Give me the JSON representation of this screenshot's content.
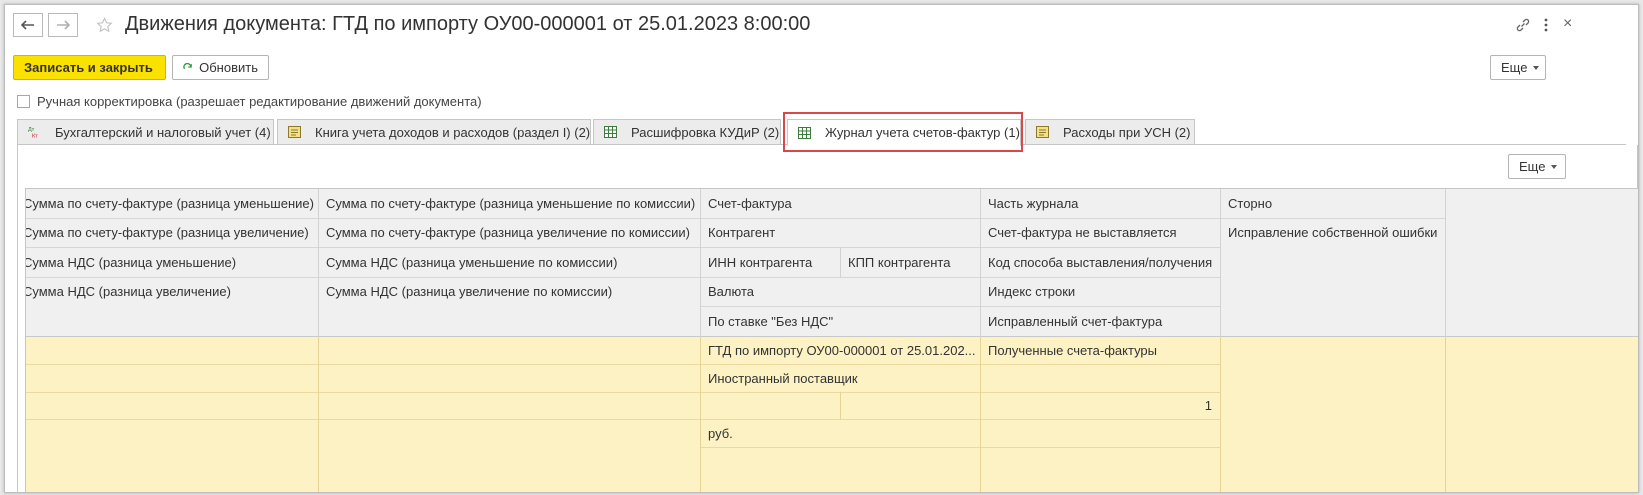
{
  "window": {
    "title": "Движения документа: ГТД по импорту ОУ00-000001 от 25.01.2023 8:00:00"
  },
  "toolbar": {
    "save_close": "Записать и закрыть",
    "refresh": "Обновить",
    "more": "Еще"
  },
  "manual_edit": {
    "label": "Ручная корректировка (разрешает редактирование движений документа)",
    "checked": false
  },
  "tabs": [
    {
      "label": "Бухгалтерский и налоговый учет (4)",
      "icon": "accounting-dt-kt-icon"
    },
    {
      "label": "Книга учета доходов и расходов (раздел I) (2)",
      "icon": "register-icon"
    },
    {
      "label": "Расшифровка КУДиР (2)",
      "icon": "table-icon"
    },
    {
      "label": "Журнал учета счетов-фактур (1)",
      "icon": "table-icon",
      "active": true
    },
    {
      "label": "Расходы при УСН (2)",
      "icon": "register-icon"
    }
  ],
  "table_more": "Еще",
  "grid": {
    "col1": [
      "Сумма по счету-фактуре (разница уменьшение)",
      "Сумма по счету-фактуре (разница увеличение)",
      "Сумма НДС (разница уменьшение)",
      "Сумма НДС (разница увеличение)"
    ],
    "col2": [
      "Сумма по счету-фактуре (разница уменьшение по комиссии)",
      "Сумма по счету-фактуре (разница увеличение по комиссии)",
      "Сумма НДС (разница уменьшение по комиссии)",
      "Сумма НДС (разница увеличение по комиссии)"
    ],
    "col3": {
      "invoice": "Счет-фактура",
      "counterparty": "Контрагент",
      "inn": "ИНН контрагента",
      "kpp": "КПП контрагента",
      "currency": "Валюта",
      "no_vat": "По ставке \"Без НДС\""
    },
    "col4": [
      "Часть журнала",
      "Счет-фактура не выставляется",
      "Код способа выставления/получения",
      "Индекс строки",
      "Исправленный счет-фактура"
    ],
    "col5": [
      "Сторно",
      "Исправление собственной ошибки"
    ]
  },
  "row": {
    "invoice": "ГТД по импорту ОУ00-000001 от 25.01.202...",
    "journal_part": "Полученные счета-фактуры",
    "counterparty": "Иностранный поставщик",
    "row_index": "1",
    "currency": "руб."
  }
}
